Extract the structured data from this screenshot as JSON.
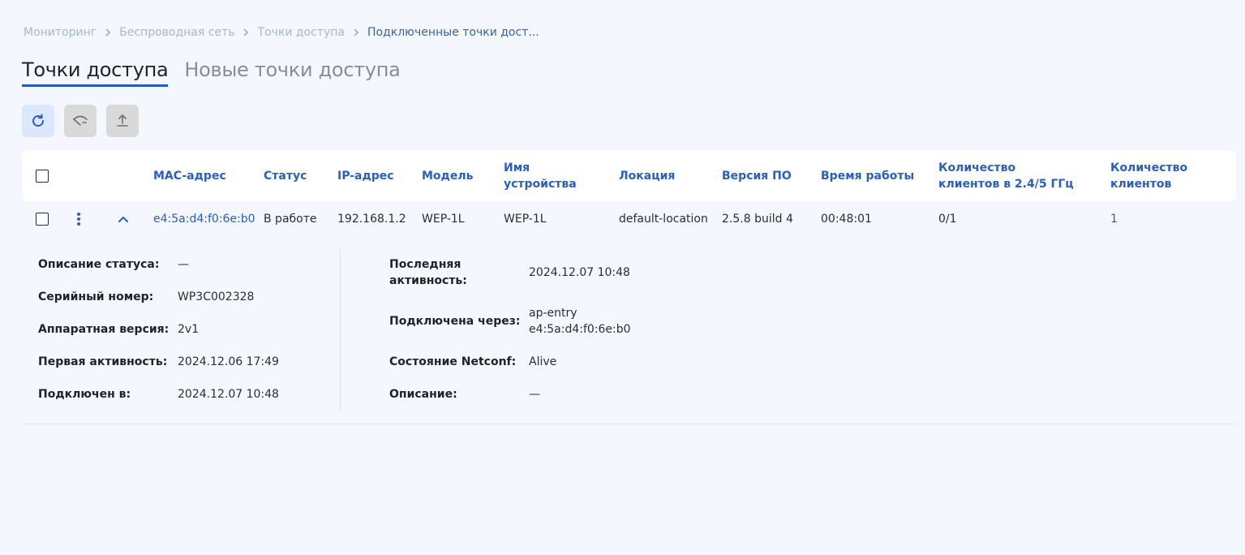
{
  "breadcrumb": [
    "Мониторинг",
    "Беспроводная сеть",
    "Точки доступа",
    "Подключенные точки дост..."
  ],
  "tabs": {
    "active": "Точки доступа",
    "inactive": "Новые точки доступа"
  },
  "toolbar": {
    "refresh_icon": "refresh-icon",
    "wifi_icon": "wifi-icon",
    "upload_icon": "upload-icon"
  },
  "table": {
    "headers": {
      "mac": "MAC-адрес",
      "status": "Статус",
      "ip": "IP-адрес",
      "model": "Модель",
      "device_name": "Имя устройства",
      "location": "Локация",
      "firmware": "Версия ПО",
      "uptime": "Время работы",
      "clients_band": "Количество клиентов в 2.4/5 ГГц",
      "clients": "Количество клиентов"
    },
    "row": {
      "mac": "e4:5a:d4:f0:6e:b0",
      "status": "В работе",
      "ip": "192.168.1.2",
      "model": "WEP-1L",
      "device_name": "WEP-1L",
      "location": "default-location",
      "firmware": "2.5.8 build 4",
      "uptime": "00:48:01",
      "clients_band": "0/1",
      "clients": "1"
    }
  },
  "details": {
    "left": [
      {
        "label": "Описание статуса:",
        "value": "—"
      },
      {
        "label": "Серийный номер:",
        "value": "WP3C002328"
      },
      {
        "label": "Аппаратная версия:",
        "value": "2v1"
      },
      {
        "label": "Первая активность:",
        "value": "2024.12.06 17:49"
      },
      {
        "label": "Подключен в:",
        "value": "2024.12.07 10:48"
      }
    ],
    "right": [
      {
        "label1": "Последняя",
        "label2": "активность:",
        "value": "2024.12.07 10:48"
      },
      {
        "label": "Подключена через:",
        "value1": "ap-entry",
        "value2": "e4:5a:d4:f0:6e:b0"
      },
      {
        "label": "Состояние Netconf:",
        "value": "Alive"
      },
      {
        "label": "Описание:",
        "value": "—"
      }
    ]
  },
  "colors": {
    "accent": "#2b5fbd",
    "background": "#f4f7fe",
    "tab_underline": "#2958b5"
  }
}
